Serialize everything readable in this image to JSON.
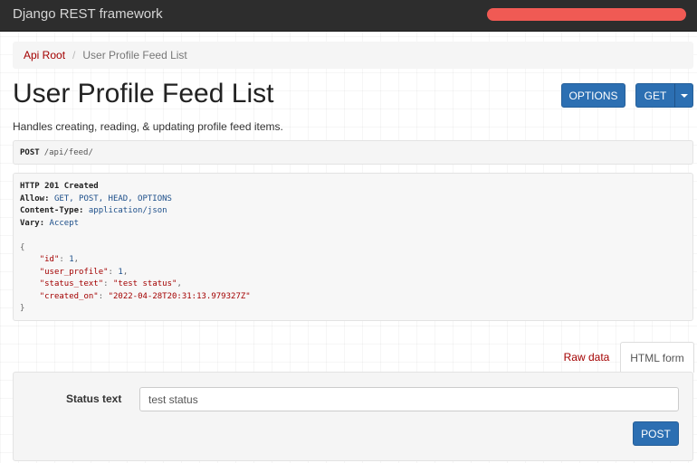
{
  "navbar": {
    "brand": "Django REST framework"
  },
  "breadcrumb": {
    "items": [
      "Api Root",
      "User Profile Feed List"
    ],
    "separator": "/"
  },
  "page": {
    "title": "User Profile Feed List",
    "description": "Handles creating, reading, & updating profile feed items."
  },
  "actions": {
    "options_label": "OPTIONS",
    "get_label": "GET"
  },
  "request": {
    "method": "POST",
    "path": "/api/feed/"
  },
  "response": {
    "status": "HTTP 201 Created",
    "headers": [
      {
        "name": "Allow",
        "value": "GET, POST, HEAD, OPTIONS"
      },
      {
        "name": "Content-Type",
        "value": "application/json"
      },
      {
        "name": "Vary",
        "value": "Accept"
      }
    ],
    "body_open": "{",
    "body_close": "}",
    "fields": [
      {
        "key": "\"id\"",
        "value": "1",
        "type": "number",
        "comma": true
      },
      {
        "key": "\"user_profile\"",
        "value": "1",
        "type": "number",
        "comma": true
      },
      {
        "key": "\"status_text\"",
        "value": "\"test status\"",
        "type": "string",
        "comma": true
      },
      {
        "key": "\"created_on\"",
        "value": "\"2022-04-28T20:31:13.979327Z\"",
        "type": "string",
        "comma": false
      }
    ]
  },
  "tabs": {
    "raw_data": "Raw data",
    "html_form": "HTML form"
  },
  "form": {
    "status_text_label": "Status text",
    "status_text_value": "test status",
    "submit_label": "POST"
  },
  "colors": {
    "navbar_bg": "#2d2d2d",
    "primary_button": "#2c6fb2",
    "link": "#a30000",
    "user_menu": "#f05a54"
  }
}
